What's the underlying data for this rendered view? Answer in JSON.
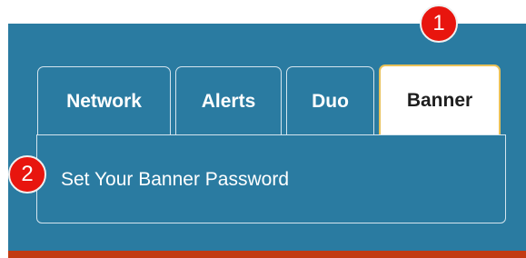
{
  "tabs": [
    {
      "label": "Network",
      "active": false
    },
    {
      "label": "Alerts",
      "active": false
    },
    {
      "label": "Duo",
      "active": false
    },
    {
      "label": "Banner",
      "active": true
    }
  ],
  "content": {
    "link_text": "Set Your Banner Password"
  },
  "callouts": [
    {
      "number": "1"
    },
    {
      "number": "2"
    }
  ],
  "colors": {
    "panel_background": "#2a7ba1",
    "active_tab_border": "#e9c158",
    "callout_badge": "#e8150e",
    "bottom_strip": "#c23a12"
  }
}
